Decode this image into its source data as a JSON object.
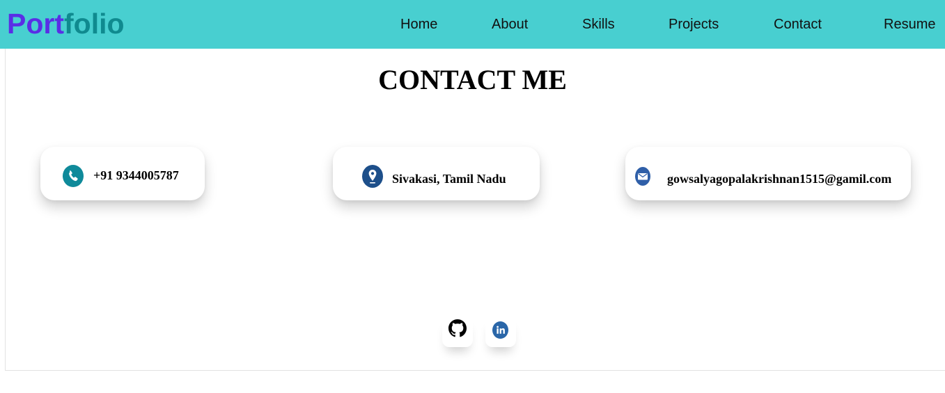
{
  "navbar": {
    "logo_part1": "Port",
    "logo_part2": "folio",
    "links": [
      "Home",
      "About",
      "Skills",
      "Projects",
      "Contact",
      "Resume"
    ]
  },
  "contact": {
    "title": "CONTACT ME",
    "phone": "+91 9344005787",
    "location": "Sivakasi, Tamil Nadu",
    "email": "gowsalyagopalakrishnan1515@gamil.com"
  },
  "icons": {
    "phone": "phone-icon",
    "location": "location-pin-icon",
    "email": "envelope-icon",
    "github": "github-icon",
    "linkedin": "linkedin-icon"
  },
  "colors": {
    "navbar_bg": "#48cfd0",
    "logo_primary": "#5a2ee6",
    "logo_secondary": "#0f8a8f",
    "phone_icon": "#0f8a9a",
    "location_icon": "#1d4f8a",
    "email_icon": "#2f5fa8",
    "linkedin_icon": "#2a66a8"
  }
}
